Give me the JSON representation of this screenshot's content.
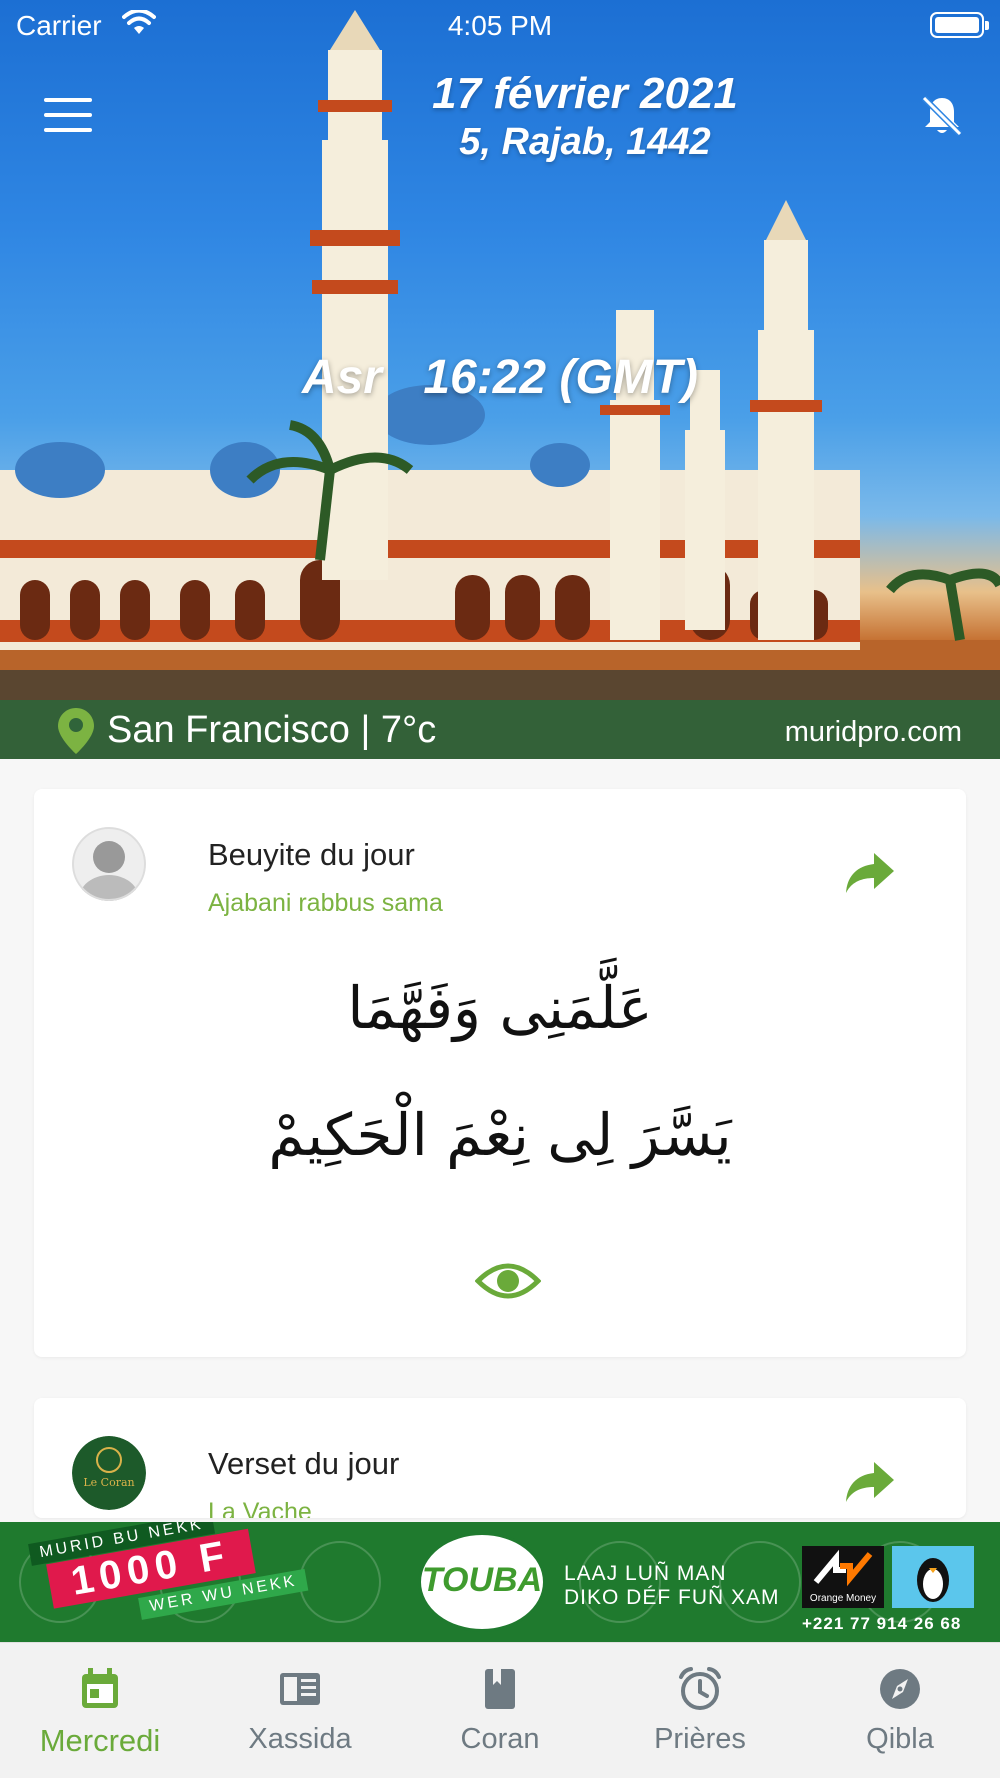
{
  "status_bar": {
    "carrier": "Carrier",
    "time": "4:05 PM"
  },
  "header": {
    "gregorian_date": "17 février 2021",
    "hijri_date": "5, Rajab, 1442",
    "current_prayer_name": "Asr",
    "current_prayer_time": "16:22 (GMT)",
    "location": "San Francisco | 7°c",
    "website": "muridpro.com"
  },
  "cards": [
    {
      "title": "Beuyite du jour",
      "subtitle": "Ajabani rabbus sama",
      "verse_lines": [
        "عَلَّمَنِى وَفَهَّمَا",
        "يَسَّرَ لِى نِعْمَ الْحَكِيمْ"
      ]
    },
    {
      "title": "Verset du jour",
      "subtitle": "La Vache",
      "avatar_text": "Le Coran"
    }
  ],
  "ad": {
    "ribbon_top": "MURID BU NEKK",
    "price": "1000 F",
    "ribbon_bottom": "WER WU NEKK",
    "logo_text": "TOUBA",
    "slogan_line1": "LAAJ LUÑ MAN",
    "slogan_line2": "DIKO DÉF FUÑ XAM",
    "orange_money_label": "Orange Money",
    "phone": "+221 77 914 26 68"
  },
  "tabs": [
    {
      "label": "Mercredi",
      "icon": "calendar-icon",
      "active": true
    },
    {
      "label": "Xassida",
      "icon": "book-open-icon",
      "active": false
    },
    {
      "label": "Coran",
      "icon": "book-icon",
      "active": false
    },
    {
      "label": "Prières",
      "icon": "alarm-clock-icon",
      "active": false
    },
    {
      "label": "Qibla",
      "icon": "compass-icon",
      "active": false
    }
  ],
  "colors": {
    "accent_green": "#7cb342",
    "tab_active": "#6aaa3a",
    "tab_inactive": "#6e7a82",
    "location_bar": "#30643a"
  }
}
